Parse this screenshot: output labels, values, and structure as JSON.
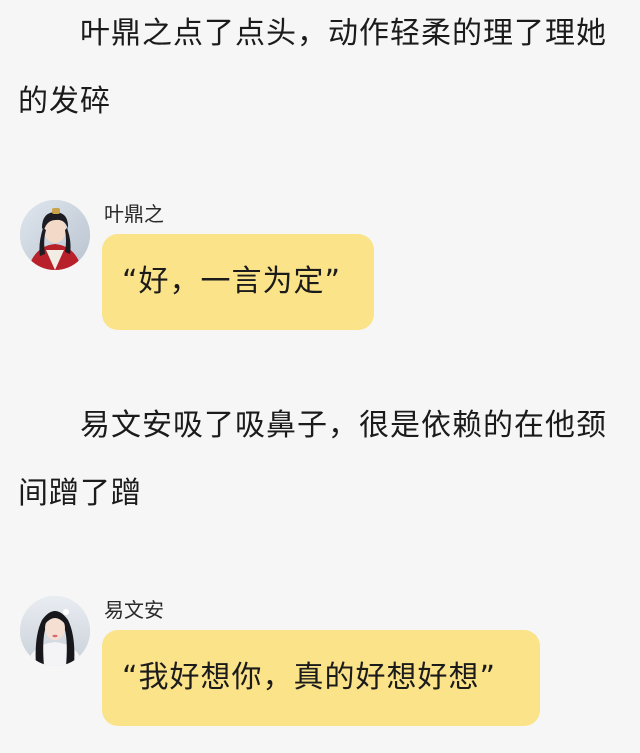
{
  "narration": [
    {
      "text": "叶鼎之点了点头，动作轻柔的理了理她的发碎"
    },
    {
      "text": "易文安吸了吸鼻子，很是依赖的在他颈间蹭了蹭"
    }
  ],
  "messages": [
    {
      "sender": "叶鼎之",
      "text": "“好，一言为定”",
      "avatar_icon": "male-character-portrait"
    },
    {
      "sender": "易文安",
      "text": "“我好想你，真的好想好想”",
      "avatar_icon": "female-character-portrait"
    }
  ],
  "colors": {
    "background": "#f6f6f6",
    "bubble": "#fbe38a",
    "text": "#1b1b1b"
  }
}
